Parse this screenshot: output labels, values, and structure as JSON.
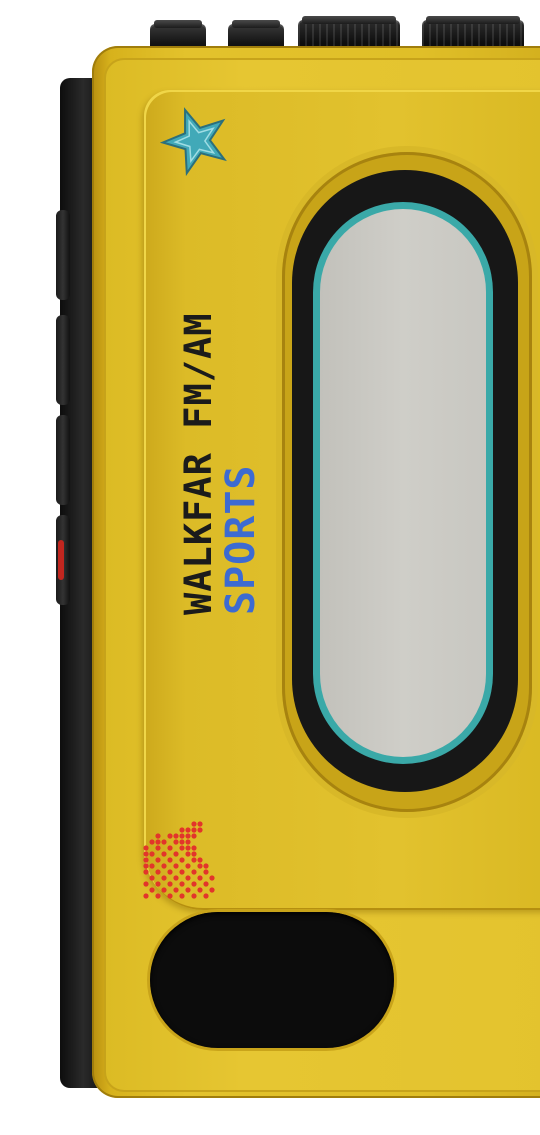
{
  "device": {
    "brand": "WALKFAR FM/AM",
    "model": "SPORTS"
  },
  "icons": {
    "logo": "star-icon",
    "speaker": "speaker-grille-icon"
  },
  "colors": {
    "body": "#e3c22c",
    "brand_text": "#1b1b1b",
    "model_text": "#3d6bd1",
    "window_ring": "#3aa9a8",
    "star": "#41a9b8",
    "speaker_dots": "#e2352a"
  }
}
